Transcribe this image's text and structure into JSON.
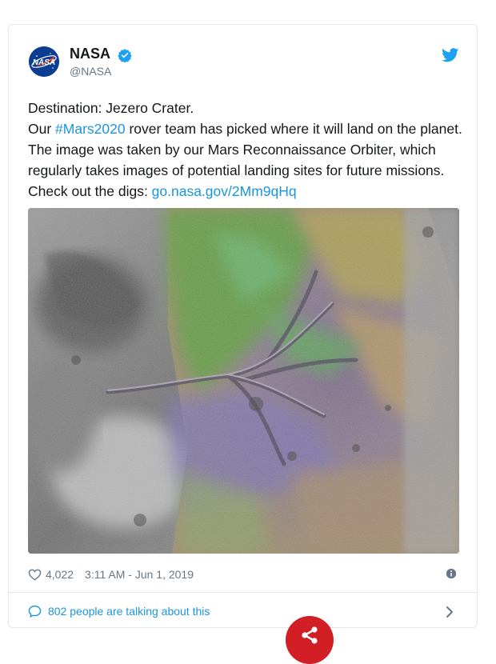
{
  "account": {
    "name": "NASA",
    "handle": "@NASA",
    "logo_text": "NASA"
  },
  "tweet": {
    "line1": "Destination: Jezero Crater.",
    "line2_prefix": "Our ",
    "hashtag": "#Mars2020",
    "line2_rest": " rover team has picked where it will land on the planet. The image was taken by our Mars Reconnaissance Orbiter, which regularly takes images of potential landing sites for future missions. Check out the digs: ",
    "link": "go.nasa.gov/2Mm9qHq"
  },
  "meta": {
    "likes": "4,022",
    "timestamp": "3:11 AM - Jun 1, 2019"
  },
  "footer": {
    "talking": "802 people are talking about this"
  },
  "icons": {
    "verified": "verified-badge-icon",
    "bird": "twitter-bird-icon",
    "heart": "heart-icon",
    "info": "info-icon",
    "bubble": "speech-bubble-icon",
    "chevron": "chevron-right-icon",
    "share": "share-icon"
  },
  "colors": {
    "accent": "#1b95e0",
    "secondary_text": "#657786",
    "border": "#e1e8ed",
    "share_button": "#d21f26",
    "nasa_blue": "#0b3d91"
  }
}
